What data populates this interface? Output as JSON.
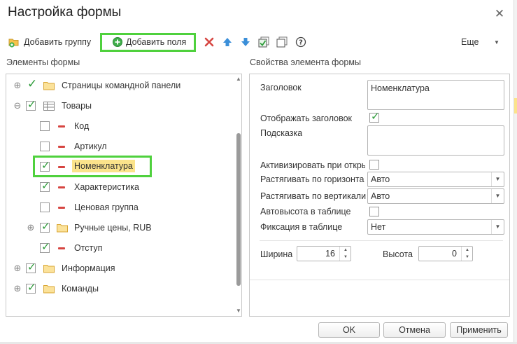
{
  "window": {
    "title": "Настройка формы"
  },
  "toolbar": {
    "add_group_label": "Добавить группу",
    "add_fields_label": "Добавить поля",
    "more_label": "Еще",
    "icons": [
      "folder-plus-icon",
      "plus-circle-icon",
      "delete-icon",
      "arrow-up-icon",
      "arrow-down-icon",
      "check-all-icon",
      "uncheck-all-icon",
      "help-icon"
    ]
  },
  "left_panel": {
    "title": "Элементы формы",
    "items": [
      {
        "label": "Страницы командной панели",
        "checked": true,
        "level": 0,
        "icon": "folder-icon"
      },
      {
        "label": "Товары",
        "checked": true,
        "level": 0,
        "icon": "table-icon"
      },
      {
        "label": "Код",
        "checked": false,
        "level": 1,
        "icon": "field-icon"
      },
      {
        "label": "Артикул",
        "checked": false,
        "level": 1,
        "icon": "field-icon"
      },
      {
        "label": "Номенклатура",
        "checked": true,
        "level": 1,
        "icon": "field-icon",
        "selected": true
      },
      {
        "label": "Характеристика",
        "checked": true,
        "level": 1,
        "icon": "field-icon"
      },
      {
        "label": "Ценовая группа",
        "checked": false,
        "level": 1,
        "icon": "field-icon"
      },
      {
        "label": "Ручные цены, RUB",
        "checked": true,
        "level": 1,
        "icon": "folder-icon"
      },
      {
        "label": "Отступ",
        "checked": true,
        "level": 1,
        "icon": "field-icon"
      },
      {
        "label": "Информация",
        "checked": true,
        "level": 0,
        "icon": "folder-icon"
      },
      {
        "label": "Команды",
        "checked": true,
        "level": 0,
        "icon": "folder-icon"
      }
    ]
  },
  "right_panel": {
    "title": "Свойства элемента формы",
    "heading_label": "Заголовок",
    "heading_value": "Номенклатура",
    "show_heading_label": "Отображать заголовок",
    "show_heading_checked": true,
    "hint_label": "Подсказка",
    "hint_value": "",
    "activate_label": "Активизировать при откры",
    "activate_checked": false,
    "stretch_h_label": "Растягивать по горизонта",
    "stretch_h_value": "Авто",
    "stretch_v_label": "Растягивать по вертикали",
    "stretch_v_value": "Авто",
    "autoheight_label": "Автовысота в таблице",
    "autoheight_checked": false,
    "fixation_label": "Фиксация в таблице",
    "fixation_value": "Нет",
    "width_label": "Ширина",
    "width_value": "16",
    "height_label": "Высота",
    "height_value": "0"
  },
  "buttons": {
    "ok": "OK",
    "cancel": "Отмена",
    "apply": "Применить"
  },
  "colors": {
    "accent_highlight": "#4fd13d",
    "selection": "#fbe38b",
    "check": "#2e9c3a",
    "delete": "#d64541",
    "arrow": "#3b8fd9"
  }
}
